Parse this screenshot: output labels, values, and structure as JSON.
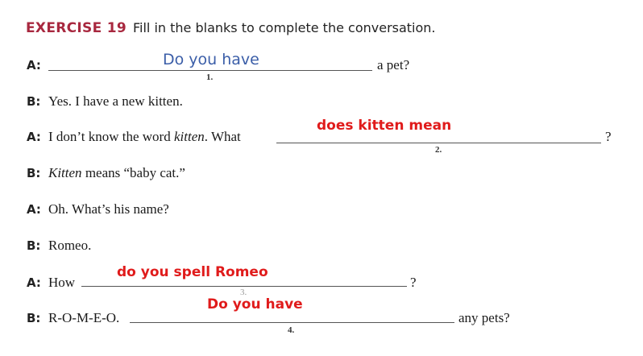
{
  "header": {
    "exercise_label": "EXERCISE 19",
    "instruction": "Fill in the blanks to complete the conversation."
  },
  "conversation": [
    {
      "speaker": "A:",
      "before": "",
      "after": "a pet?",
      "number": "1.",
      "answer": "Do you have"
    },
    {
      "speaker": "B:",
      "text": "Yes. I have a new kitten."
    },
    {
      "speaker": "A:",
      "before_plain": "I don’t know the word ",
      "before_italic": "kitten",
      "before_end": ". What",
      "after": "?",
      "number": "2.",
      "answer": "does kitten mean"
    },
    {
      "speaker": "B:",
      "text_italic": "Kitten",
      "text": " means “baby cat.”"
    },
    {
      "speaker": "A:",
      "text": "Oh. What’s his name?"
    },
    {
      "speaker": "B:",
      "text": "Romeo."
    },
    {
      "speaker": "A:",
      "before": "How",
      "after": "?",
      "number": "3.",
      "answer": "do you spell Romeo"
    },
    {
      "speaker": "B:",
      "before": "R-O-M-E-O.",
      "after": "any pets?",
      "number": "4.",
      "answer": "Do you have"
    }
  ],
  "colors": {
    "exercise_label": "#a8283f",
    "handwriting_blue": "#3b5ea8",
    "handwriting_red": "#e01b1b"
  }
}
